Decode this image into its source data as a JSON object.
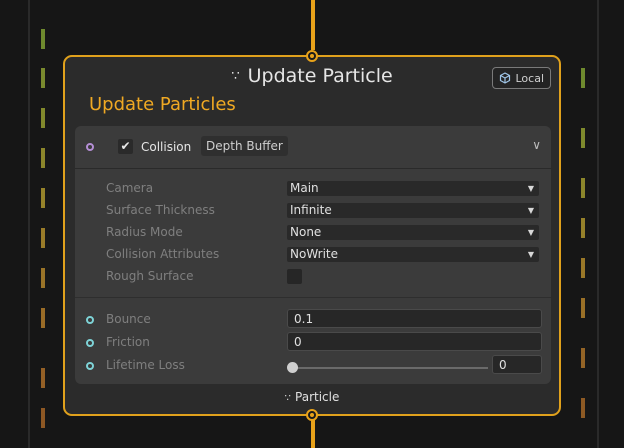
{
  "node": {
    "title": "Update Particle",
    "title_icon": "particle-dots-icon",
    "space_badge": "Local",
    "space_icon": "local-cube-icon",
    "subtitle": "Update Particles",
    "output_label": "Particle"
  },
  "block": {
    "enabled": true,
    "title": "Collision",
    "tag": "Depth Buffer",
    "settings": [
      {
        "label": "Camera",
        "value": "Main"
      },
      {
        "label": "Surface Thickness",
        "value": "Infinite"
      },
      {
        "label": "Radius Mode",
        "value": "None"
      },
      {
        "label": "Collision Attributes",
        "value": "NoWrite"
      },
      {
        "label": "Rough Surface",
        "value": false
      }
    ],
    "properties": [
      {
        "label": "Bounce",
        "value": "0.1"
      },
      {
        "label": "Friction",
        "value": "0"
      },
      {
        "label": "Lifetime Loss",
        "value": "0"
      }
    ]
  },
  "colors": {
    "accent": "#e0a11c",
    "subtitle": "#f0a923",
    "block_slot": "#b58fd6",
    "property_slot": "#7ed3d7"
  }
}
